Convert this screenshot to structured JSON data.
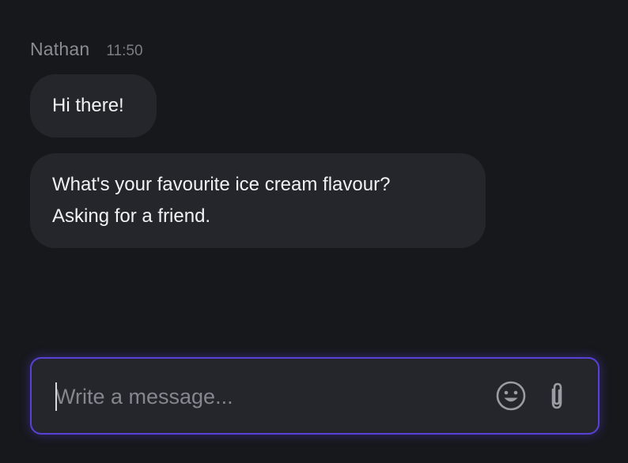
{
  "message": {
    "sender": "Nathan",
    "time": "11:50",
    "bubbles": [
      {
        "lines": [
          "Hi there!"
        ]
      },
      {
        "lines": [
          "What's your favourite ice cream flavour?",
          "Asking for a friend."
        ]
      }
    ]
  },
  "composer": {
    "placeholder": "Write a message...",
    "value": "",
    "emoji_icon": "emoji-icon",
    "attach_icon": "paperclip-icon"
  },
  "colors": {
    "background": "#17181c",
    "bubble": "#25262c",
    "accent": "#5643d6",
    "text": "#f2f2f4",
    "muted": "#8a8c93"
  }
}
